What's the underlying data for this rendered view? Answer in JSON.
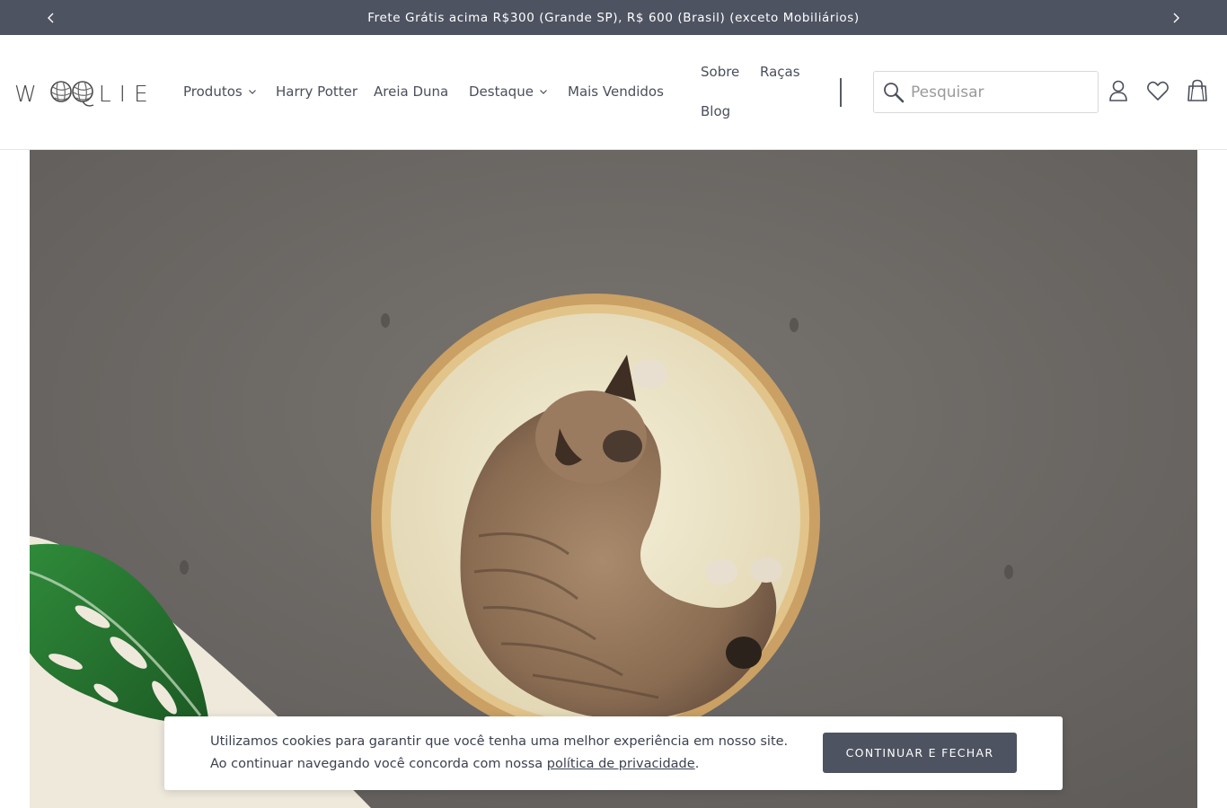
{
  "announcement": {
    "message": "Frete Grátis acima R$300 (Grande SP), R$ 600 (Brasil) (exceto Mobiliários)",
    "prev_icon": "chevron-left-icon",
    "next_icon": "chevron-right-icon"
  },
  "header": {
    "logo_left": "W",
    "logo_right": "LIE",
    "nav": [
      {
        "label": "Produtos",
        "has_dropdown": true
      },
      {
        "label": "Harry Potter",
        "has_dropdown": false
      },
      {
        "label": "Areia Duna",
        "has_dropdown": false
      },
      {
        "label": "Destaque",
        "has_dropdown": true
      },
      {
        "label": "Mais Vendidos",
        "has_dropdown": false
      },
      {
        "label": "Sobre",
        "has_dropdown": false
      },
      {
        "label": "Raças",
        "has_dropdown": false
      },
      {
        "label": "Blog",
        "has_dropdown": false
      }
    ],
    "search": {
      "placeholder": "Pesquisar",
      "value": ""
    },
    "icons": [
      "search-icon",
      "account-icon",
      "wishlist-heart-icon",
      "cart-bag-icon"
    ]
  },
  "hero": {
    "image": "cat-sleeping-in-round-bed"
  },
  "cookie_banner": {
    "text_before_link": "Utilizamos cookies para garantir que você tenha uma melhor experiência em nosso site. Ao continuar navegando você concorda com nossa ",
    "link_text": "política de privacidade",
    "text_after_link": ".",
    "button_label": "CONTINUAR E FECHAR"
  },
  "colors": {
    "announcement_bg": "#4e5361",
    "button_bg": "#4e5361",
    "text": "#4a4f5b"
  }
}
